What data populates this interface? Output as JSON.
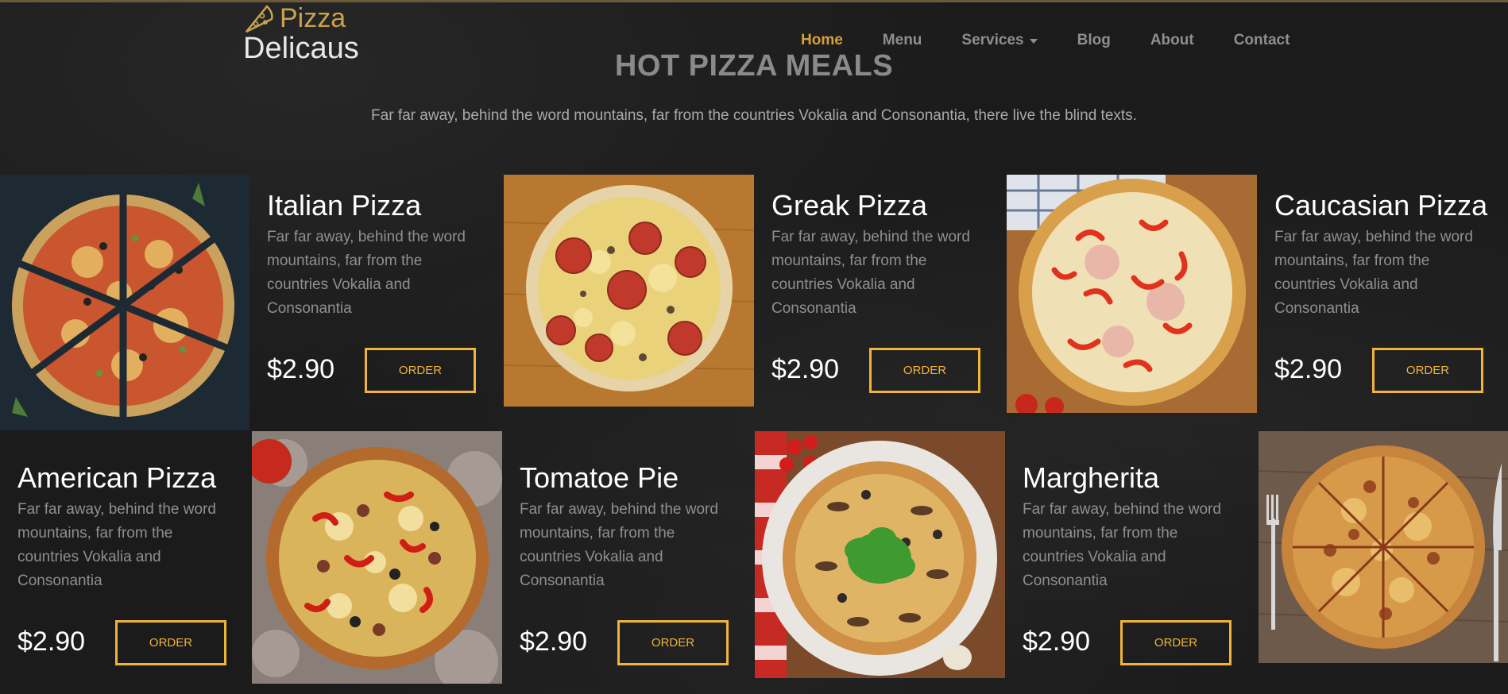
{
  "brand": {
    "line1": "Pizza",
    "line2": "Delicaus"
  },
  "nav": [
    {
      "label": "Home",
      "active": true
    },
    {
      "label": "Menu"
    },
    {
      "label": "Services",
      "dropdown": true
    },
    {
      "label": "Blog"
    },
    {
      "label": "About"
    },
    {
      "label": "Contact"
    }
  ],
  "section": {
    "title": "HOT PIZZA MEALS",
    "subtitle": "Far far away, behind the word mountains, far from the countries Vokalia and Consonantia, there live the blind texts."
  },
  "items": [
    {
      "name": "Italian Pizza",
      "desc": "Far far away, behind the word mountains, far from the countries Vokalia and Consonantia",
      "price": "$2.90",
      "order": "ORDER"
    },
    {
      "name": "Greak Pizza",
      "desc": "Far far away, behind the word mountains, far from the countries Vokalia and Consonantia",
      "price": "$2.90",
      "order": "ORDER"
    },
    {
      "name": "Caucasian Pizza",
      "desc": "Far far away, behind the word mountains, far from the countries Vokalia and Consonantia",
      "price": "$2.90",
      "order": "ORDER"
    },
    {
      "name": "American Pizza",
      "desc": "Far far away, behind the word mountains, far from the countries Vokalia and Consonantia",
      "price": "$2.90",
      "order": "ORDER"
    },
    {
      "name": "Tomatoe Pie",
      "desc": "Far far away, behind the word mountains, far from the countries Vokalia and Consonantia",
      "price": "$2.90",
      "order": "ORDER"
    },
    {
      "name": "Margherita",
      "desc": "Far far away, behind the word mountains, far from the countries Vokalia and Consonantia",
      "price": "$2.90",
      "order": "ORDER"
    }
  ],
  "colors": {
    "accent": "#f0b43a",
    "nav_active": "#d89f33",
    "background": "#1b1b1c"
  }
}
